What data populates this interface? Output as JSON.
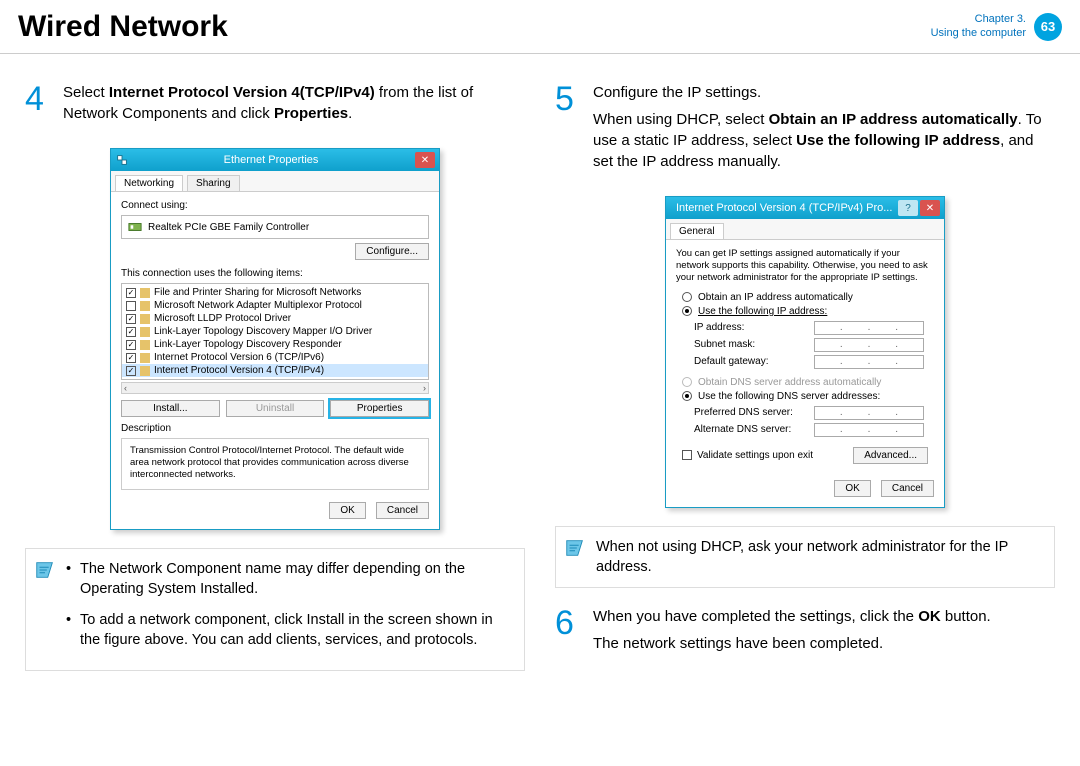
{
  "header": {
    "title": "Wired Network",
    "chapter": "Chapter 3.",
    "subtitle": "Using the computer",
    "page": "63"
  },
  "step4": {
    "num": "4",
    "text_a": "Select ",
    "text_b": "Internet Protocol Version 4(TCP/IPv4)",
    "text_c": " from the list of Network Components and click ",
    "text_d": "Properties",
    "text_e": "."
  },
  "step5": {
    "num": "5",
    "line1": "Configure the IP settings.",
    "line2a": "When using DHCP, select ",
    "line2b": "Obtain an IP address automatically",
    "line2c": ". To use a static IP address, select ",
    "line2d": "Use the following IP address",
    "line2e": ", and set the IP address manually."
  },
  "step6": {
    "num": "6",
    "line1a": "When you have completed the settings, click the ",
    "line1b": "OK",
    "line1c": " button.",
    "line2": "The network settings have been completed."
  },
  "note_left": {
    "bullet1": "The Network Component name may differ depending on the Operating System Installed.",
    "bullet2": "To add a network component, click Install in the screen shown in the figure above. You can add clients, services, and protocols."
  },
  "note_right": {
    "text": "When not using DHCP, ask your network administrator for the IP address."
  },
  "eth_dialog": {
    "title": "Ethernet Properties",
    "tab1": "Networking",
    "tab2": "Sharing",
    "connect_label": "Connect using:",
    "device": "Realtek PCIe GBE Family Controller",
    "configure_btn": "Configure...",
    "items_label": "This connection uses the following items:",
    "items": [
      "File and Printer Sharing for Microsoft Networks",
      "Microsoft Network Adapter Multiplexor Protocol",
      "Microsoft LLDP Protocol Driver",
      "Link-Layer Topology Discovery Mapper I/O Driver",
      "Link-Layer Topology Discovery Responder",
      "Internet Protocol Version 6 (TCP/IPv6)",
      "Internet Protocol Version 4 (TCP/IPv4)"
    ],
    "item_checks": [
      true,
      false,
      true,
      true,
      true,
      true,
      true
    ],
    "install_btn": "Install...",
    "uninstall_btn": "Uninstall",
    "properties_btn": "Properties",
    "desc_label": "Description",
    "desc_text": "Transmission Control Protocol/Internet Protocol. The default wide area network protocol that provides communication across diverse interconnected networks.",
    "ok": "OK",
    "cancel": "Cancel"
  },
  "tcp_dialog": {
    "title": "Internet Protocol Version 4 (TCP/IPv4) Pro...",
    "tab": "General",
    "para": "You can get IP settings assigned automatically if your network supports this capability. Otherwise, you need to ask your network administrator for the appropriate IP settings.",
    "r1": "Obtain an IP address automatically",
    "r2": "Use the following IP address:",
    "lbl_ip": "IP address:",
    "lbl_mask": "Subnet mask:",
    "lbl_gw": "Default gateway:",
    "r3": "Obtain DNS server address automatically",
    "r4": "Use the following DNS server addresses:",
    "lbl_pdns": "Preferred DNS server:",
    "lbl_adns": "Alternate DNS server:",
    "validate": "Validate settings upon exit",
    "advanced": "Advanced...",
    "ok": "OK",
    "cancel": "Cancel"
  }
}
